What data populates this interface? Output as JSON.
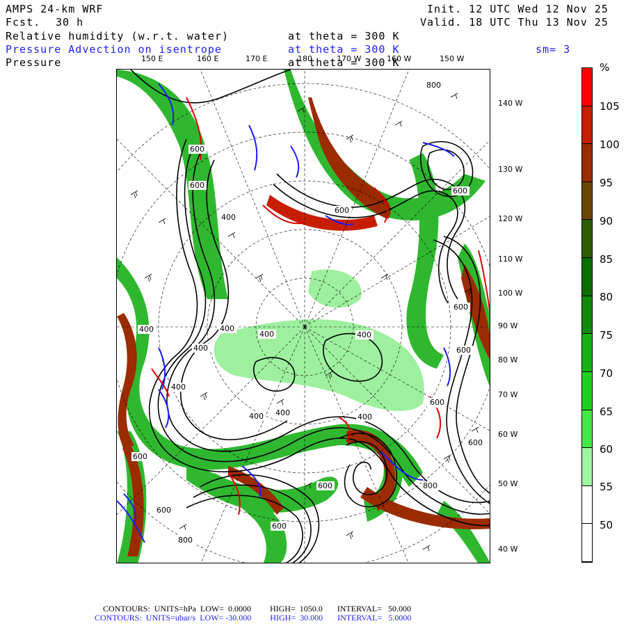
{
  "header": {
    "model": "AMPS 24-km WRF",
    "fcst_label": "Fcst.",
    "fcst_value": "30 h",
    "init": "Init. 12 UTC Wed 12 Nov 25",
    "valid": "Valid. 18 UTC Thu 13 Nov 25",
    "line1_field": "Relative humidity (w.r.t. water)",
    "line1_level": "at theta = 300 K",
    "line2_field": "Pressure Advection on isentrope",
    "line2_level": "at theta = 300 K",
    "smoothing": "sm= 3",
    "line3_field": "Pressure",
    "line3_level": "at theta = 300 K"
  },
  "top_ticks": [
    {
      "label": "150 E"
    },
    {
      "label": "160 E"
    },
    {
      "label": "170 E"
    },
    {
      "label": "180"
    },
    {
      "label": "170 W"
    },
    {
      "label": "160 W"
    },
    {
      "label": "150 W"
    }
  ],
  "right_ticks": [
    {
      "label": "140 W"
    },
    {
      "label": "130 W"
    },
    {
      "label": "120 W"
    },
    {
      "label": "110 W"
    },
    {
      "label": "100 W"
    },
    {
      "label": "90 W"
    },
    {
      "label": "80 W"
    },
    {
      "label": "70 W"
    },
    {
      "label": "60 W"
    },
    {
      "label": "50 W"
    },
    {
      "label": "40 W"
    }
  ],
  "contour_labels": [
    {
      "text": "800"
    },
    {
      "text": "600"
    },
    {
      "text": "600"
    },
    {
      "text": "600"
    },
    {
      "text": "400"
    },
    {
      "text": "600"
    },
    {
      "text": "400"
    },
    {
      "text": "400"
    },
    {
      "text": "400"
    },
    {
      "text": "400"
    },
    {
      "text": "400"
    },
    {
      "text": "600"
    },
    {
      "text": "400"
    },
    {
      "text": "400"
    },
    {
      "text": "400"
    },
    {
      "text": "400"
    },
    {
      "text": "400"
    },
    {
      "text": "600"
    },
    {
      "text": "600"
    },
    {
      "text": "600"
    },
    {
      "text": "600"
    },
    {
      "text": "800"
    },
    {
      "text": "800"
    },
    {
      "text": "600"
    },
    {
      "text": "600"
    },
    {
      "text": "600"
    }
  ],
  "colorbar": {
    "unit": "%",
    "labels": [
      "105",
      "100",
      "95",
      "90",
      "85",
      "80",
      "75",
      "70",
      "65",
      "60",
      "55",
      "50"
    ],
    "colors": [
      "#ff0000",
      "#c81e00",
      "#9b2b00",
      "#6b4400",
      "#2f5d00",
      "#0b6e00",
      "#0d8a0a",
      "#13b412",
      "#1fd11f",
      "#44ea44",
      "#a0f5a0",
      "#ffffff",
      "#ffffff"
    ]
  },
  "colors": {
    "rh_green": "#2fb82f",
    "rh_light": "#9ef09e",
    "rh_dark": "#9b2b00",
    "rh_red": "#ff1a1a",
    "advection_blue": "#1c1cff",
    "advection_red": "#e00000",
    "pressure_black": "#000000"
  },
  "footer": {
    "line1": "CONTOURS:  UNITS=hPa  LOW=  0.0000         HIGH=  1050.0       INTERVAL=   50.000",
    "line2": "CONTOURS:  UNITS=ubar/s  LOW= -30.000         HIGH=  30.000       INTERVAL=   5.0000"
  }
}
